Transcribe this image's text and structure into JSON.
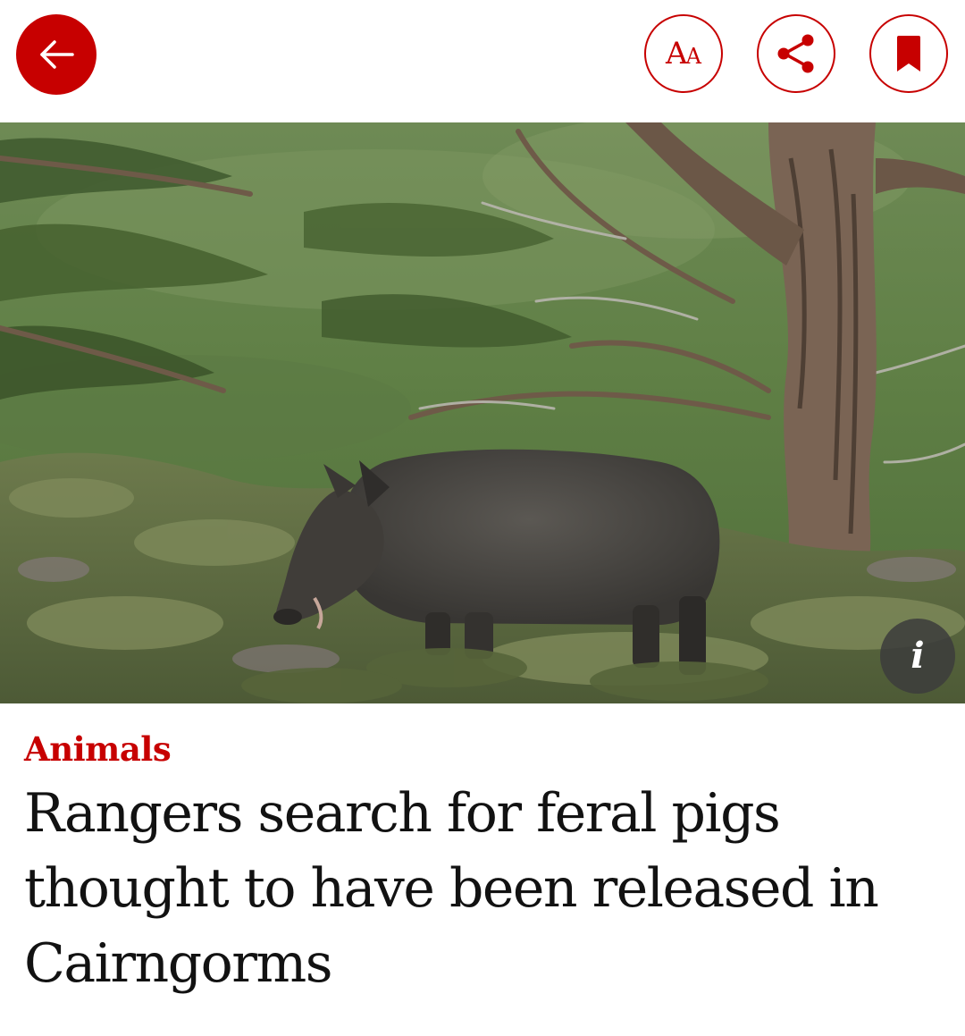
{
  "header": {
    "back_icon": "arrow-left-icon",
    "text_size": {
      "icon": "text-size-icon",
      "glyph_large": "A",
      "glyph_small": "A"
    },
    "share_icon": "share-icon",
    "bookmark_icon": "bookmark-icon"
  },
  "hero": {
    "info_icon": "info-icon",
    "info_glyph": "i"
  },
  "article": {
    "kicker": "Animals",
    "headline": "Rangers search for feral pigs thought to have been released in Cairngorms"
  },
  "colors": {
    "brand_red": "#c70000",
    "headline_text": "#121212",
    "background": "#ffffff"
  }
}
